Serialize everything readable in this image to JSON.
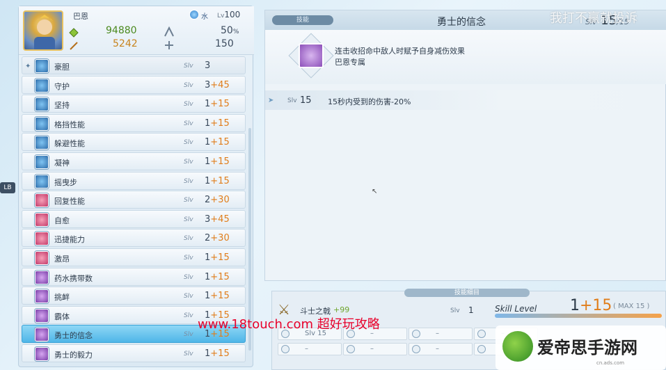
{
  "character": {
    "name": "巴恩",
    "element": "水",
    "level_prefix": "Lv",
    "level": "100",
    "hp": "94880",
    "atk": "5242",
    "stat_pct": "50",
    "stat_pct_unit": "%",
    "stat_num": "150"
  },
  "skills": [
    {
      "name": "豪胆",
      "slv_label": "Slv",
      "slv": "3",
      "plus": "",
      "icon": "blue"
    },
    {
      "name": "守护",
      "slv_label": "Slv",
      "slv": "3",
      "plus": "+45",
      "icon": "blue"
    },
    {
      "name": "坚持",
      "slv_label": "Slv",
      "slv": "1",
      "plus": "+15",
      "icon": "blue"
    },
    {
      "name": "格挡性能",
      "slv_label": "Slv",
      "slv": "1",
      "plus": "+15",
      "icon": "blue"
    },
    {
      "name": "躲避性能",
      "slv_label": "Slv",
      "slv": "1",
      "plus": "+15",
      "icon": "blue"
    },
    {
      "name": "凝神",
      "slv_label": "Slv",
      "slv": "1",
      "plus": "+15",
      "icon": "blue"
    },
    {
      "name": "摇曳步",
      "slv_label": "Slv",
      "slv": "1",
      "plus": "+15",
      "icon": "blue"
    },
    {
      "name": "回复性能",
      "slv_label": "Slv",
      "slv": "2",
      "plus": "+30",
      "icon": "pink"
    },
    {
      "name": "自愈",
      "slv_label": "Slv",
      "slv": "3",
      "plus": "+45",
      "icon": "pink"
    },
    {
      "name": "迅捷能力",
      "slv_label": "Slv",
      "slv": "2",
      "plus": "+30",
      "icon": "pink"
    },
    {
      "name": "激昂",
      "slv_label": "Slv",
      "slv": "1",
      "plus": "+15",
      "icon": "pink"
    },
    {
      "name": "药水携带数",
      "slv_label": "Slv",
      "slv": "1",
      "plus": "+15",
      "icon": "purple"
    },
    {
      "name": "挑衅",
      "slv_label": "Slv",
      "slv": "1",
      "plus": "+15",
      "icon": "purple"
    },
    {
      "name": "霸体",
      "slv_label": "Slv",
      "slv": "1",
      "plus": "+15",
      "icon": "purple"
    },
    {
      "name": "勇士的信念",
      "slv_label": "Slv",
      "slv": "1",
      "plus": "+15",
      "icon": "purple",
      "selected": true
    },
    {
      "name": "勇士的毅力",
      "slv_label": "Slv",
      "slv": "1",
      "plus": "+15",
      "icon": "purple"
    }
  ],
  "detail": {
    "tag": "技能",
    "title": "勇士的信念",
    "slv_prefix": "Slv",
    "slv": "15",
    "slv_suffix": "/15",
    "desc_line1": "连击收招命中敌人时赋予自身减伤效果",
    "desc_line2": "巴恩专属",
    "effect_slv_label": "Slv",
    "effect_slv": "15",
    "effect_text": "15秒内受到的伤害-20%"
  },
  "bottom": {
    "tree_label": "技能细目",
    "weapon_name": "斗士之戟",
    "weapon_bonus": "+99",
    "slv_label": "Slv",
    "slv": "1",
    "skill_level_label": "Skill Level",
    "skill_level_base": "1",
    "skill_level_plus": "+15",
    "max_label": "( MAX 15 )",
    "grid": [
      {
        "text": "Slv 15"
      },
      {
        "text": "–"
      },
      {
        "text": "–"
      },
      {
        "text": "–"
      },
      {
        "text": "–"
      },
      {
        "text": "–"
      },
      {
        "text": "–"
      },
      {
        "text": "–"
      }
    ]
  },
  "overlays": {
    "watermark_top": "我打不赢就投诉",
    "watermark_red": "www.18touch.com 超好玩攻略",
    "logo_text": "爱帝思手游网",
    "logo_sub": "cn.ads.com",
    "lb_tab": "LB"
  },
  "colors": {
    "accent_orange": "#e07d1a",
    "hp_green": "#4b8a1f",
    "atk_gold": "#c7831d",
    "selected_blue": "#4fb6e8"
  }
}
